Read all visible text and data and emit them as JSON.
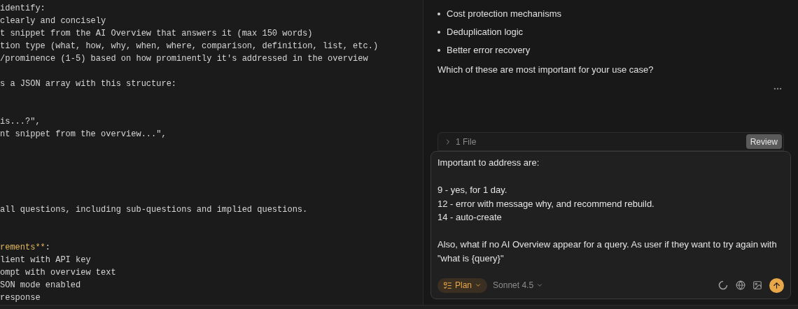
{
  "editor": {
    "lines": [
      {
        "kind": "code",
        "text": "identify:"
      },
      {
        "kind": "code",
        "text": "clearly and concisely"
      },
      {
        "kind": "code",
        "text": "t snippet from the AI Overview that answers it (max 150 words)"
      },
      {
        "kind": "code",
        "text": "tion type (what, how, why, when, where, comparison, definition, list, etc.)"
      },
      {
        "kind": "code",
        "text": "/prominence (1-5) based on how prominently it's addressed in the overview"
      },
      {
        "kind": "blank"
      },
      {
        "kind": "code",
        "text": "s a JSON array with this structure:"
      },
      {
        "kind": "blank"
      },
      {
        "kind": "blank"
      },
      {
        "kind": "code",
        "text": "is...?\","
      },
      {
        "kind": "code",
        "text": "nt snippet from the overview...\","
      },
      {
        "kind": "blank"
      },
      {
        "kind": "blank"
      },
      {
        "kind": "blank"
      },
      {
        "kind": "blank"
      },
      {
        "kind": "blank"
      },
      {
        "kind": "code",
        "text": "all questions, including sub-questions and implied questions."
      },
      {
        "kind": "blank"
      },
      {
        "kind": "blank"
      },
      {
        "kind": "mixed",
        "parts": [
          {
            "kind": "emphasis",
            "text": "rements**"
          },
          {
            "kind": "plain",
            "text": ":"
          }
        ]
      },
      {
        "kind": "code",
        "text": "lient with API key"
      },
      {
        "kind": "code",
        "text": "ompt with overview text"
      },
      {
        "kind": "code",
        "text": "SON mode enabled"
      },
      {
        "kind": "code",
        "text": "response"
      }
    ]
  },
  "chat": {
    "bullets": [
      "Cost protection mechanisms",
      "Deduplication logic",
      "Better error recovery"
    ],
    "question": "Which of these are most important for your use case?",
    "files": {
      "label": "1 File",
      "expanded": false,
      "review_button": "Review"
    },
    "composer": {
      "value": "Important to address are:\n\n9 - yes, for 1 day.\n12 - error with message why, and recommend rebuild.\n14 - auto-create\n\nAlso, what if no AI Overview appear for a query. As user if they want to try again with \"what is {query}\"",
      "mode": "Plan",
      "model": "Sonnet 4.5"
    }
  }
}
